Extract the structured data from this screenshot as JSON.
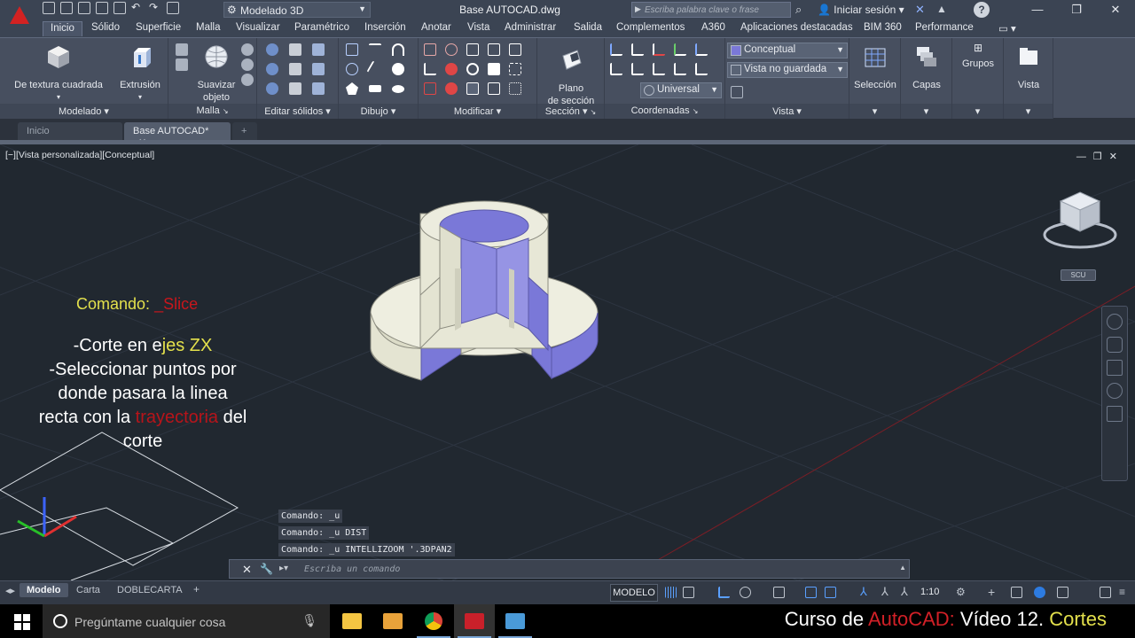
{
  "titlebar": {
    "workspace": "Modelado 3D",
    "doc_title": "Base AUTOCAD.dwg",
    "search_placeholder": "Escriba palabra clave o frase",
    "signin": "Iniciar sesión"
  },
  "ribbon_tabs": [
    "Inicio",
    "Sólido",
    "Superficie",
    "Malla",
    "Visualizar",
    "Paramétrico",
    "Inserción",
    "Anotar",
    "Vista",
    "Administrar",
    "Salida",
    "Complementos",
    "A360",
    "Aplicaciones destacadas",
    "BIM 360",
    "Performance"
  ],
  "ribbon": {
    "panels": {
      "modelado": "Modelado",
      "malla": "Malla",
      "editar_solidos": "Editar sólidos",
      "dibujo": "Dibujo",
      "modificar": "Modificar",
      "seccion": "Sección",
      "coordenadas": "Coordenadas",
      "vista": "Vista"
    },
    "buttons": {
      "textura": "De textura cuadrada",
      "extrusion": "Extrusión",
      "suavizar_1": "Suavizar",
      "suavizar_2": "objeto",
      "plano_1": "Plano",
      "plano_2": "de sección",
      "seleccion": "Selección",
      "capas": "Capas",
      "grupos": "Grupos",
      "vista": "Vista"
    },
    "combos": {
      "visual_style": "Conceptual",
      "named_view": "Vista no guardada",
      "ucs": "Universal"
    }
  },
  "doc_tabs": {
    "start": "Inicio",
    "active": "Base AUTOCAD*"
  },
  "viewport": {
    "label": "[−][Vista personalizada][Conceptual]",
    "scu": "SCU"
  },
  "overlay": {
    "cmd_prefix": "Comando: ",
    "cmd_value": "_Slice",
    "line1_a": "-Corte en e",
    "line1_b": "jes ZX",
    "line2": "-Seleccionar puntos por",
    "line3": "donde pasara la linea",
    "line4_a": "recta con la ",
    "line4_b": "trayectoria",
    "line4_c": " del",
    "line5": "corte"
  },
  "command": {
    "history": [
      "Comando: _u",
      "Comando: _u DIST",
      "Comando: _u INTELLIZOOM '.3DPAN2"
    ],
    "placeholder": "Escriba un comando"
  },
  "statusbar": {
    "layouts": [
      "Modelo",
      "Carta",
      "DOBLECARTA"
    ],
    "model_button": "MODELO",
    "scale": "1:10"
  },
  "taskbar": {
    "cortana": "Pregúntame cualquier cosa"
  },
  "caption": {
    "a": "Curso de ",
    "b": "AutoCAD:",
    "c": " Vídeo 12. ",
    "d": "Cortes"
  },
  "colors": {
    "accent_red": "#d32222",
    "cmd_yellow": "#e3e04c",
    "solid_face": "#e6e6d6",
    "solid_inner": "#7a78d8"
  }
}
